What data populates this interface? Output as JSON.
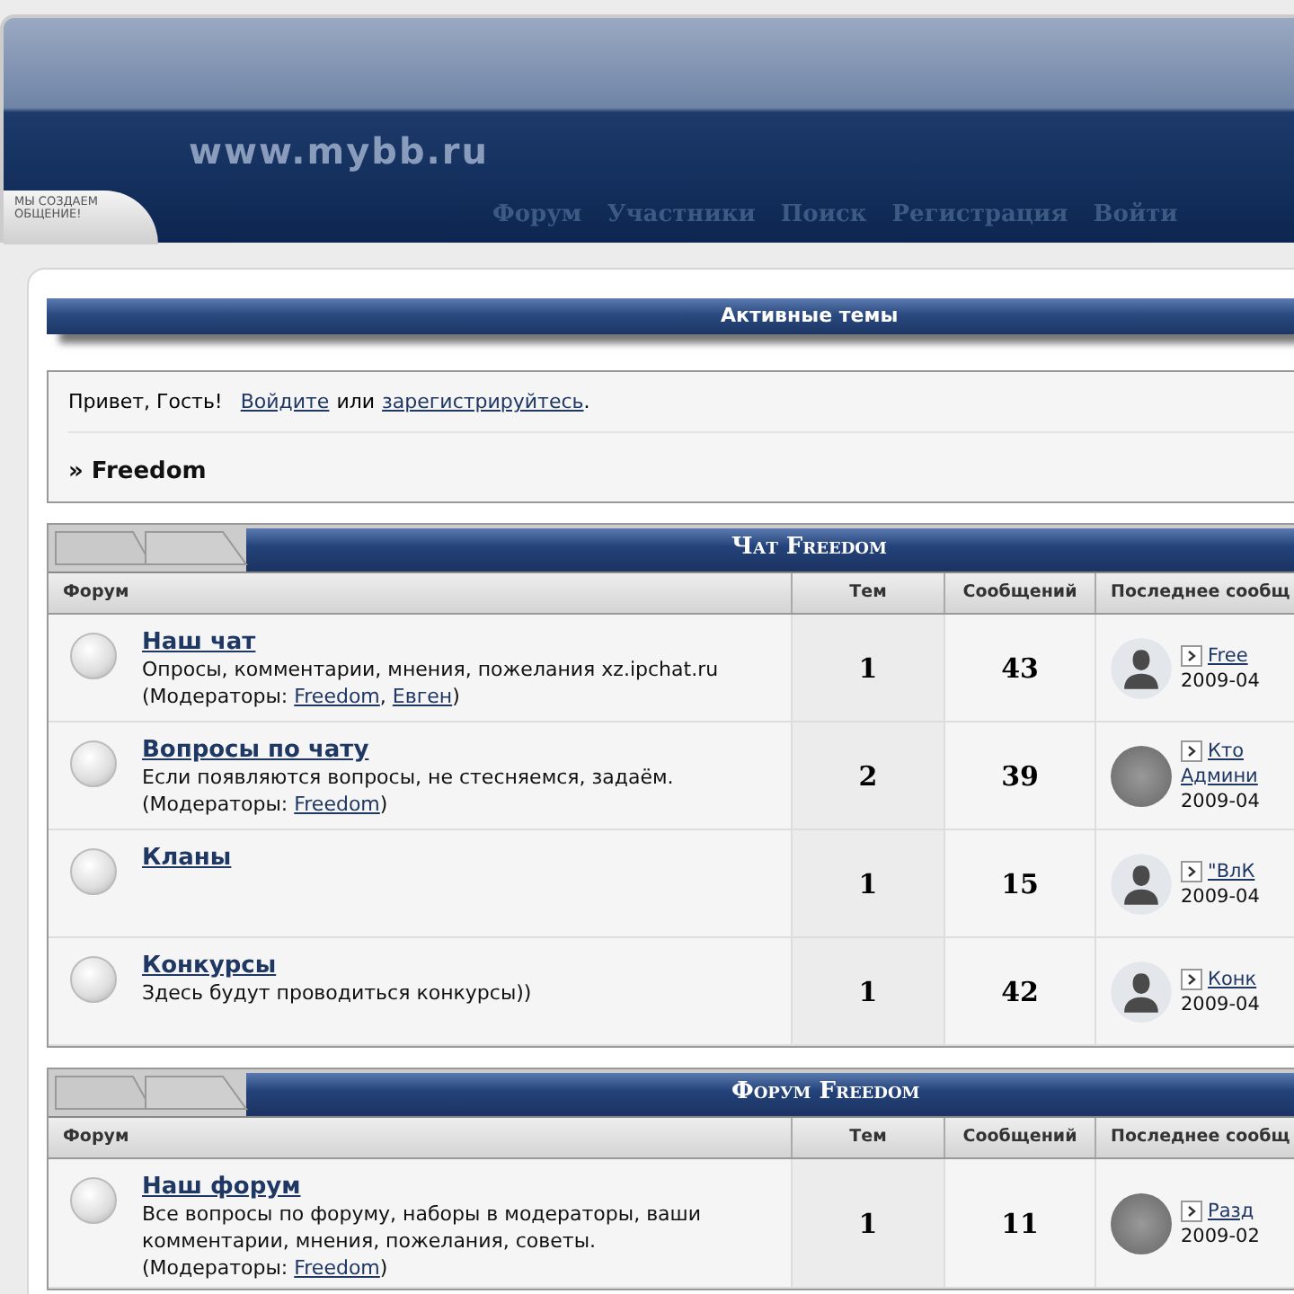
{
  "header": {
    "site": "www.mybb.ru",
    "badge": "МЫ СОЗДАЕМ ОБЩЕНИЕ!",
    "nav": [
      "Форум",
      "Участники",
      "Поиск",
      "Регистрация",
      "Войти"
    ]
  },
  "active_topics": "Активные темы",
  "welcome": {
    "greeting": "Привет, Гость!",
    "login": "Войдите",
    "or": "или",
    "register": "зарегистрируйтесь",
    "end": ".",
    "breadcrumb": "» Freedom"
  },
  "categories": [
    {
      "title": "Чат Freedom",
      "columns": [
        "Форум",
        "Тем",
        "Сообщений",
        "Последнее сообщ"
      ],
      "forums": [
        {
          "name": "Наш чат",
          "description": "Опросы, комментарии, мнения, пожелания xz.ipchat.ru",
          "moderators_label": "(Модераторы: ",
          "moderators": [
            "Freedom",
            "Евген"
          ],
          "separator": ", ",
          "close": ")",
          "topics": "1",
          "posts": "43",
          "avatar": {
            "kind": "silhouette"
          },
          "last_post": [
            "Free"
          ],
          "date": "2009-04"
        },
        {
          "name": "Вопросы по чату",
          "description": "Если появляются вопросы, не стесняемся, задаём.",
          "moderators_label": "(Модераторы: ",
          "moderators": [
            "Freedom"
          ],
          "close": ")",
          "topics": "2",
          "posts": "39",
          "avatar": {
            "kind": "photo"
          },
          "last_post": [
            "Кто",
            "Админи"
          ],
          "date": "2009-04"
        },
        {
          "name": "Кланы",
          "topics": "1",
          "posts": "15",
          "avatar": {
            "kind": "silhouette"
          },
          "last_post": [
            "\"ВлК"
          ],
          "date": "2009-04"
        },
        {
          "name": "Конкурсы",
          "description": "Здесь будут проводиться конкурсы))",
          "topics": "1",
          "posts": "42",
          "avatar": {
            "kind": "silhouette"
          },
          "last_post": [
            "Конк"
          ],
          "date": "2009-04"
        }
      ]
    },
    {
      "title": "Форум Freedom",
      "columns": [
        "Форум",
        "Тем",
        "Сообщений",
        "Последнее сообщ"
      ],
      "forums": [
        {
          "name": "Наш форум",
          "description": "Все вопросы по форуму, наборы в модераторы, ваши комментарии, мнения, пожелания, советы.",
          "moderators_label": "(Модераторы: ",
          "moderators": [
            "Freedom"
          ],
          "close": ")",
          "topics": "1",
          "posts": "11",
          "avatar": {
            "kind": "photo"
          },
          "last_post": [
            "Разд"
          ],
          "date": "2009-02"
        }
      ]
    }
  ]
}
